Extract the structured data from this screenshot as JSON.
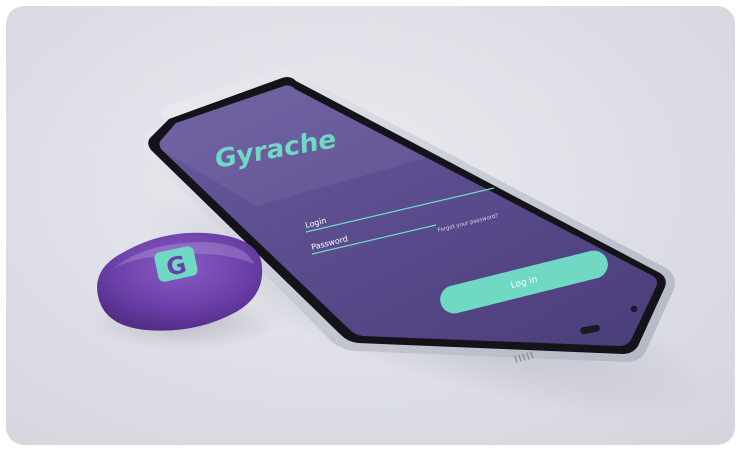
{
  "app": {
    "logo_text": "Gyrache",
    "login_label": "Login",
    "password_label": "Password",
    "forgot_password_link": "Forgot your password?",
    "login_button_label": "Log in"
  },
  "colors": {
    "screen_background": "#5b4c8e",
    "accent": "#6fd9c4",
    "device_purple": "#6b3fa8",
    "background": "#e2e3ea"
  },
  "device_logo_letter": "G"
}
